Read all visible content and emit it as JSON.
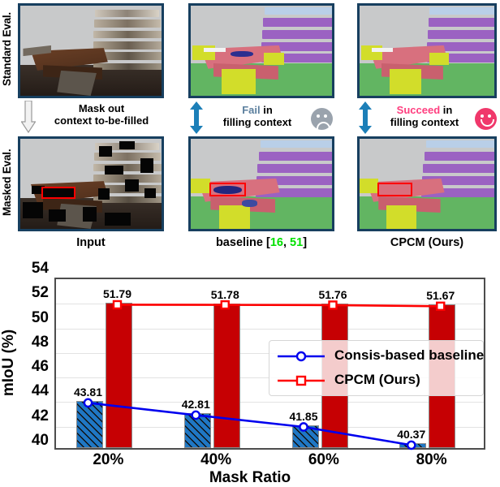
{
  "figure": {
    "row_labels": [
      {
        "id": "standard-eval",
        "text": "Standard Eval."
      },
      {
        "id": "masked-eval",
        "text": "Masked Eval."
      }
    ],
    "mask_arrow_caption": "Mask out\ncontext to-be-filled",
    "mask_arrow_caption_line1": "Mask out",
    "mask_arrow_caption_line2": "context to-be-filled",
    "middle": {
      "fail_word": "Fail",
      "fail_rest": " in",
      "fail_line2": "filling context",
      "succeed_word": "Succeed",
      "succeed_rest": " in",
      "succeed_line2": "filling context",
      "fail_face": "sad-face-icon",
      "succeed_face": "happy-face-icon",
      "fail_face_color": "#9aa3ad",
      "succeed_face_color": "#f0386b"
    },
    "panel_captions": {
      "input": "Input",
      "baseline_prefix": "baseline [",
      "baseline_ref1": "16",
      "baseline_sep": ", ",
      "baseline_ref2": "51",
      "baseline_suffix": "]",
      "cpcm": "CPCM (Ours)"
    },
    "panel_border_color": "#173f5f",
    "ref_color": "#00e000"
  },
  "chart_data": {
    "type": "bar",
    "title": "",
    "xlabel": "Mask Ratio",
    "ylabel": "mIoU (%)",
    "categories": [
      "20%",
      "40%",
      "60%",
      "80%"
    ],
    "ylim": [
      40,
      54
    ],
    "yticks": [
      40,
      42,
      44,
      46,
      48,
      50,
      52,
      54
    ],
    "grid": true,
    "legend_position": "center-right",
    "series": [
      {
        "name": "Consis-based baseline",
        "color": "#0000ee",
        "marker": "circle",
        "bar_color": "#1f77c4",
        "hatch": "diagonal",
        "values": [
          43.81,
          42.81,
          41.85,
          40.37
        ],
        "labels": [
          "43.81",
          "42.81",
          "41.85",
          "40.37"
        ]
      },
      {
        "name": "CPCM (Ours)",
        "color": "#ff0000",
        "marker": "square",
        "bar_color": "#c60003",
        "hatch": "none",
        "values": [
          51.79,
          51.78,
          51.76,
          51.67
        ],
        "labels": [
          "51.79",
          "51.78",
          "51.76",
          "51.67"
        ]
      }
    ]
  }
}
